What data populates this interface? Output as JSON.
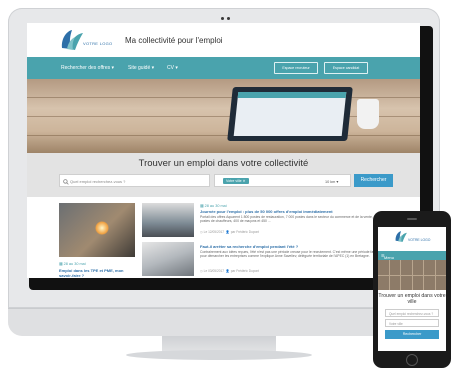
{
  "site": {
    "logo_text": "VOTRE LOGO",
    "title": "Ma collectivité pour l'emploi"
  },
  "nav": {
    "items": [
      "Rechercher des offres",
      "Site guidé",
      "CV"
    ],
    "buttons": [
      "Espace recruteur",
      "Espace candidat"
    ]
  },
  "search": {
    "title": "Trouver un emploi dans votre collectivité",
    "keyword_placeholder": "Quel emploi recherchez-vous ?",
    "location_chip": "Votre ville",
    "radius": "10 km",
    "button": "Rechercher"
  },
  "news": [
    {
      "date": "28 au 30 mai",
      "title": "Emploi dans les TPE et PME, mon savoir-faire ?"
    },
    {
      "date": "28 au 30 mai",
      "title": "Journée pour l'emploi : plus de 50 000 offres d'emploi immédiatement",
      "body": "Portail des offres Aquarent 1 800 postes de restauration, 7 000 postes dans le secteur du commerce et de la vente, 130 postes de chauffeurs, 400 de maçons et 450 ...",
      "meta_date": "Le 12/05/2017",
      "meta_author": "par Frédéric Dupont"
    },
    {
      "title": "Faut-il arrêter sa recherche d'emploi pendant l'été ?",
      "body": "Contrairement aux idées reçues, l'été n'est pas une période creuse pour le recrutement. C'est même une période favorable pour démarcher les entreprises comme l'explique Anne Saveliev, déléguée territoriale de l'APEC (1) en Bretagne.",
      "meta_date": "Le 03/05/2017",
      "meta_author": "par Frédéric Dupont"
    }
  ],
  "phone": {
    "logo_text": "VOTRE LOGO",
    "menu_label": "Menu",
    "title": "Trouver un emploi dans votre ville",
    "keyword_placeholder": "Quel emploi recherchez-vous ?",
    "location_placeholder": "Votre ville",
    "button": "Rechercher"
  },
  "colors": {
    "nav_teal": "#4aa3ad",
    "search_blue": "#3b9ac9",
    "link_blue": "#2d6fa8"
  }
}
